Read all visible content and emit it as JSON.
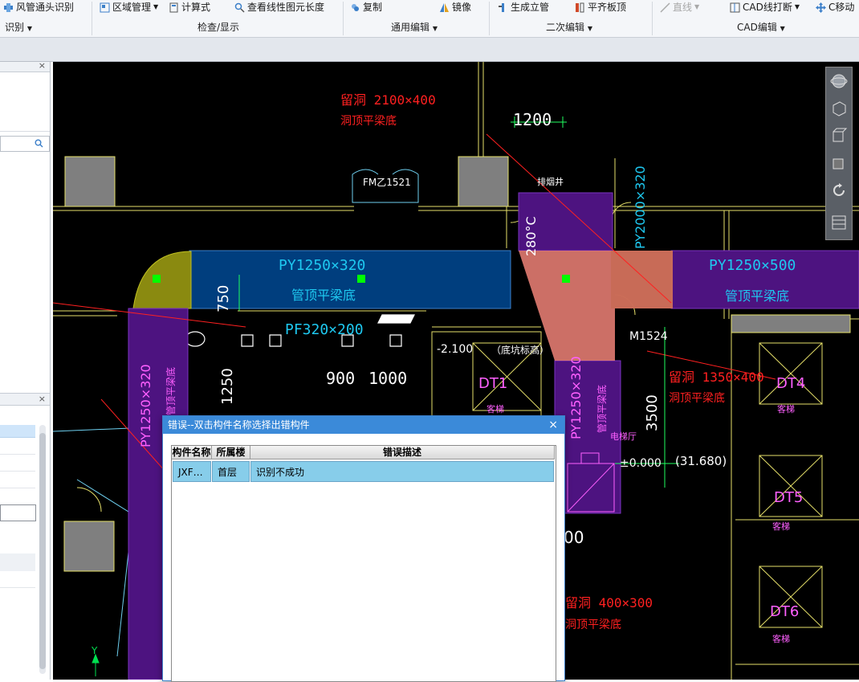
{
  "ribbon": {
    "top_buttons": [
      {
        "label": "风管通头识别",
        "icon": "duct-fitting-icon"
      },
      {
        "label": "区域管理",
        "icon": "region-icon",
        "dropdown": true
      },
      {
        "label": "计算式",
        "icon": "calculator-icon"
      },
      {
        "label": "查看线性图元长度",
        "icon": "measure-icon"
      },
      {
        "label": "复制",
        "icon": "copy-icon"
      },
      {
        "label": "镜像",
        "icon": "mirror-icon"
      },
      {
        "label": "生成立管",
        "icon": "riser-icon"
      },
      {
        "label": "平齐板顶",
        "icon": "align-top-icon"
      },
      {
        "label": "直线",
        "icon": "line-icon",
        "dropdown": true
      },
      {
        "label": "CAD线打断",
        "icon": "break-icon",
        "dropdown": true
      },
      {
        "label": "C移动",
        "icon": "move-icon"
      }
    ],
    "groups": [
      "识别",
      "检查/显示",
      "通用编辑",
      "二次编辑",
      "CAD编辑"
    ]
  },
  "cad": {
    "texts": {
      "opening1": "留洞  2100×400",
      "opening1_sub": "洞顶平梁底",
      "dim1200": "1200",
      "door_fm": "FM乙1521",
      "shaft": "排烟井",
      "py2000": "PY2000×320",
      "deg": "280°C",
      "py1250_h": "PY1250×320",
      "py1250_h_sub": "管顶平梁底",
      "py1250_500": "PY1250×500",
      "py1250_500_sub": "管顶平梁底",
      "dim750": "750",
      "pf320": "PF320×200",
      "dim1250": "1250",
      "dim900": "900",
      "dim1000": "1000",
      "level_neg": "-2.100",
      "pit": "（底坑标高）",
      "dt1": "DT1",
      "dt1_sub": "客梯",
      "m1524": "M1524",
      "opening2": "留洞  1350×400",
      "opening2_sub": "洞顶平梁底",
      "dt4": "DT4",
      "dt4_sub": "客梯",
      "dim3500": "3500",
      "py1250_v_left": "PY1250×320",
      "py1250_v_left_sub": "管顶平梁底",
      "py1250_v_mid": "PY1250×320",
      "py1250_v_mid_sub": "管顶平梁底",
      "room": "电梯厅",
      "level0": "±0.000",
      "level31": "(31.680)",
      "dt5": "DT5",
      "dt5_sub": "客梯",
      "dim00": "00",
      "opening3": "留洞  400×300",
      "opening3_sub": "洞顶平梁底",
      "dt6": "DT6",
      "dt6_sub": "客梯",
      "y_axis": "Y"
    }
  },
  "dialog": {
    "title": "错误--双击构件名称选择出错构件",
    "close": "×",
    "columns": [
      "构件名称",
      "所属楼层",
      "错误描述"
    ],
    "rows": [
      {
        "name": "JXF…",
        "floor": "首层",
        "desc": "识别不成功"
      }
    ]
  },
  "left_panel": {
    "close1": "×",
    "close2": "×"
  },
  "colors": {
    "accent": "#3b8ad9",
    "selected_row": "#87cdea",
    "cad_bg": "#000000"
  }
}
